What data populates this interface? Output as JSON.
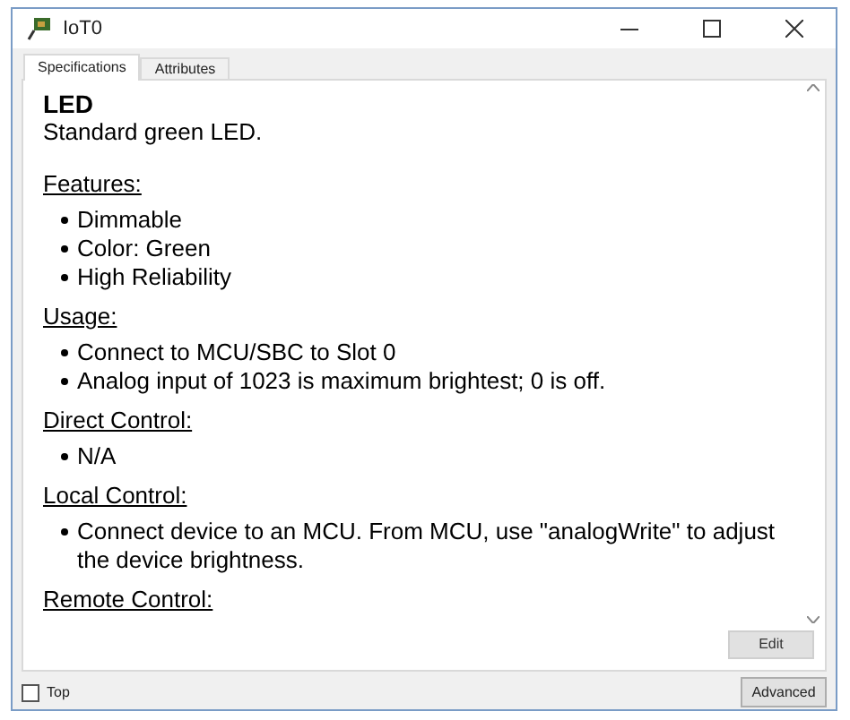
{
  "window": {
    "title": "IoT0"
  },
  "tabs": [
    {
      "label": "Specifications",
      "selected": true
    },
    {
      "label": "Attributes",
      "selected": false
    }
  ],
  "spec": {
    "title": "LED",
    "description": "Standard green LED.",
    "sections": [
      {
        "heading": "Features:",
        "items": [
          "Dimmable",
          "Color: Green",
          "High Reliability"
        ]
      },
      {
        "heading": "Usage:",
        "items": [
          "Connect to MCU/SBC to Slot 0",
          "Analog input of 1023 is maximum brightest; 0 is off."
        ]
      },
      {
        "heading": "Direct Control:",
        "items": [
          "N/A"
        ]
      },
      {
        "heading": "Local Control:",
        "items": [
          "Connect device to an MCU. From MCU, use \"analogWrite\" to adjust the device brightness."
        ]
      },
      {
        "heading": "Remote Control:"
      }
    ]
  },
  "edit_button": "Edit",
  "top_checkbox": {
    "label": "Top",
    "checked": false
  },
  "advanced_button": "Advanced"
}
